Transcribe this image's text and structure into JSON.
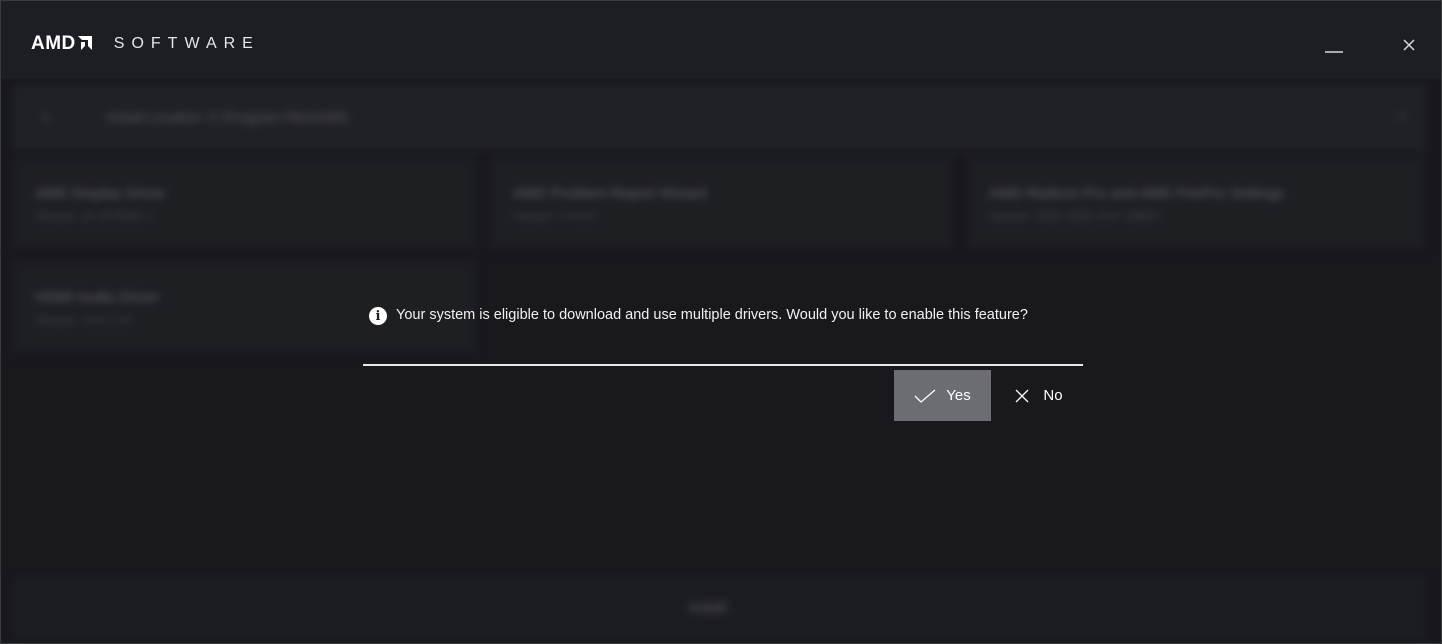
{
  "app": {
    "brand": "AMD",
    "product": "SOFTWARE"
  },
  "window_controls": {
    "minimize_icon": "minimize-icon",
    "close_icon": "close-icon"
  },
  "background": {
    "nav": {
      "back_icon": "chevron-left-icon",
      "path": "Install Location: C:\\Program Files\\AMD",
      "search_icon": "search-icon"
    },
    "components": [
      {
        "title": "AMD Display Driver",
        "version": "Version: 22.20.6042.1"
      },
      {
        "title": "AMD Problem Report Wizard",
        "version": "Version: 4.4.0.0"
      },
      {
        "title": "AMD Radeon Pro and AMD FirePro Settings",
        "version": "Version: 2022.1026.1137.20820"
      },
      {
        "title": "HDMI Audio Driver",
        "version": "Version: 10.0.1.23"
      }
    ],
    "footer_button": "Install"
  },
  "prompt": {
    "icon": "info-icon",
    "message": "Your system is eligible to download and use multiple drivers. Would you like to enable this feature?",
    "yes_label": "Yes",
    "no_label": "No"
  },
  "colors": {
    "background": "#1c1d22",
    "yes_button": "#6b6d72",
    "divider": "#e8e8e8"
  }
}
